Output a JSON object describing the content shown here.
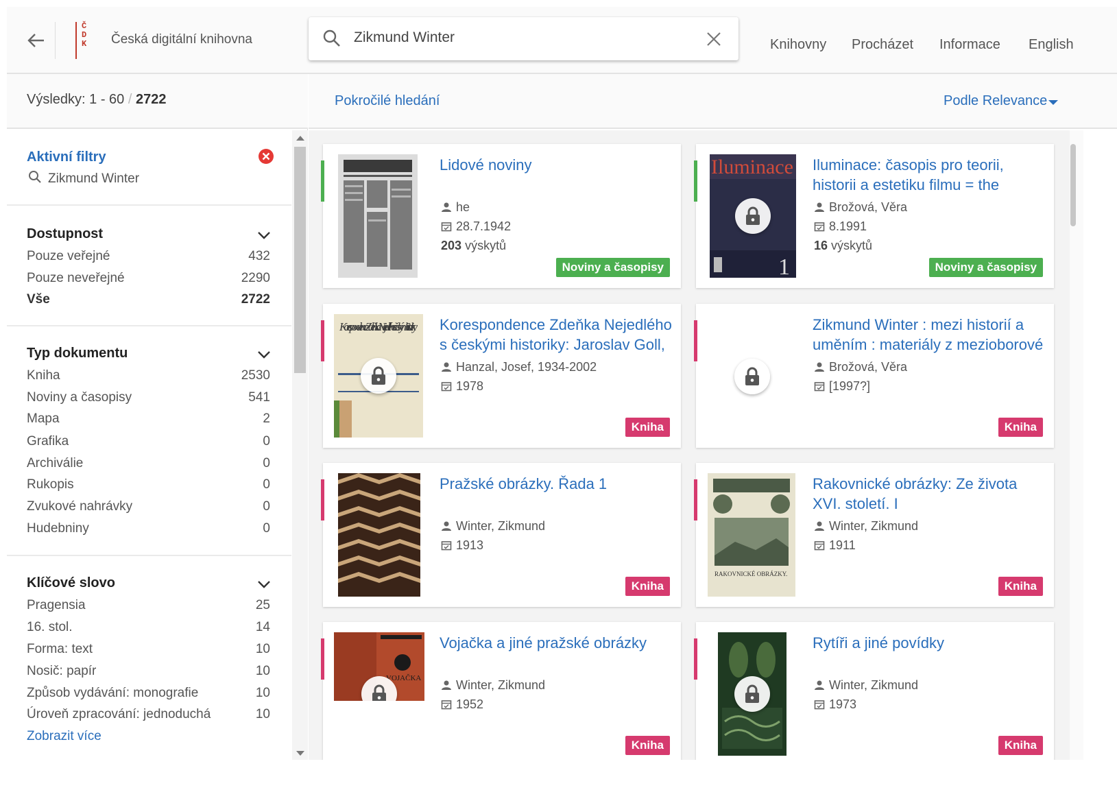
{
  "header": {
    "brand": "Česká digitální knihovna",
    "logo_letters": [
      "Č",
      "D",
      "K"
    ],
    "search_value": "Zikmund Winter",
    "nav": [
      "Knihovny",
      "Procházet",
      "Informace",
      "English"
    ]
  },
  "results": {
    "label": "Výsledky: 1 - 60",
    "sep": "/",
    "total": "2722"
  },
  "active_filters": {
    "title": "Aktivní filtry",
    "query": "Zikmund Winter"
  },
  "sections": {
    "availability": {
      "title": "Dostupnost",
      "items": [
        {
          "label": "Pouze veřejné",
          "count": "432"
        },
        {
          "label": "Pouze neveřejné",
          "count": "2290"
        },
        {
          "label": "Vše",
          "count": "2722"
        }
      ]
    },
    "doctype": {
      "title": "Typ dokumentu",
      "items": [
        {
          "label": "Kniha",
          "count": "2530"
        },
        {
          "label": "Noviny a časopisy",
          "count": "541"
        },
        {
          "label": "Mapa",
          "count": "2"
        },
        {
          "label": "Grafika",
          "count": "0"
        },
        {
          "label": "Archiválie",
          "count": "0"
        },
        {
          "label": "Rukopis",
          "count": "0"
        },
        {
          "label": "Zvukové nahrávky",
          "count": "0"
        },
        {
          "label": "Hudebniny",
          "count": "0"
        }
      ]
    },
    "keywords": {
      "title": "Klíčové slovo",
      "items": [
        {
          "label": "Pragensia",
          "count": "25"
        },
        {
          "label": "16. stol.",
          "count": "14"
        },
        {
          "label": "Forma: text",
          "count": "10"
        },
        {
          "label": "Nosič: papír",
          "count": "10"
        },
        {
          "label": "Způsob vydávání: monografie",
          "count": "10"
        },
        {
          "label": "Úroveň zpracování: jednoduchá",
          "count": "10"
        }
      ],
      "more": "Zobrazit více"
    }
  },
  "toolbar": {
    "advanced": "Pokročilé hledání",
    "sort": "Podle Relevance"
  },
  "cards": [
    {
      "title": "Lidové noviny",
      "author": "he",
      "date": "28.7.1942",
      "occ_num": "203",
      "occ_label": "výskytů",
      "badge": "Noviny a časopisy"
    },
    {
      "title": "Iluminace: časopis pro teorii, historii a estetiku filmu = the journal of film",
      "author": "Brožová, Věra",
      "date": "8.1991",
      "occ_num": "16",
      "occ_label": "výskytů",
      "badge": "Noviny a časopisy",
      "cover_text": "Iluminace",
      "cover_num": "1"
    },
    {
      "title": "Korespondence Zdeňka Nejedlého s českými historiky: Jaroslav Goll,",
      "author": "Hanzal, Josef, 1934-2002",
      "date": "1978",
      "badge": "Kniha",
      "cover_text": "Korespondence Zdeňka Nejedlého s českými historiky"
    },
    {
      "title": "Zikmund Winter : mezi historií a uměním : materiály z mezioborové",
      "author": "Brožová, Věra",
      "date": "[1997?]",
      "badge": "Kniha"
    },
    {
      "title": "Pražské obrázky. Řada 1",
      "author": "Winter, Zikmund",
      "date": "1913",
      "badge": "Kniha"
    },
    {
      "title": "Rakovnické obrázky: Ze života XVI. století. I",
      "author": "Winter, Zikmund",
      "date": "1911",
      "badge": "Kniha",
      "cover_text": "RAKOVNICKÉ OBRÁZKY."
    },
    {
      "title": "Vojačka a jiné pražské obrázky",
      "author": "Winter, Zikmund",
      "date": "1952",
      "badge": "Kniha",
      "cover_text": "VOJAČKA"
    },
    {
      "title": "Rytíři a jiné povídky",
      "author": "Winter, Zikmund",
      "date": "1973",
      "badge": "Kniha"
    }
  ],
  "colors": {
    "accent": "#2a6ebb",
    "green": "#4caf50",
    "pink": "#d63a6e",
    "logo_red": "#c0392b"
  }
}
